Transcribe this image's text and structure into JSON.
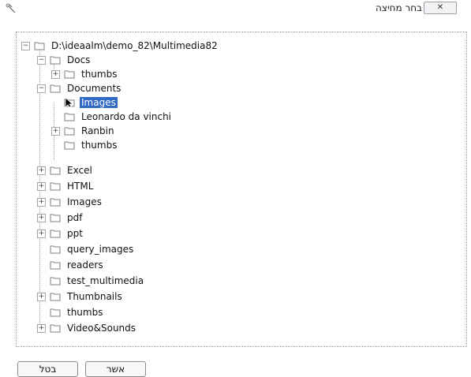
{
  "window": {
    "title": "בחר מחיצה",
    "close_glyph": "✕"
  },
  "tree": {
    "root": {
      "label": "D:\\ideaalm\\demo_82\\Multimedia82",
      "expander": "−"
    },
    "items": [
      {
        "label": "Docs",
        "expander": "−"
      },
      {
        "label": "thumbs",
        "expander": "+"
      },
      {
        "label": "Documents",
        "expander": "−"
      },
      {
        "label": "Images",
        "expander": "",
        "selected": true
      },
      {
        "label": "Leonardo da vinchi",
        "expander": ""
      },
      {
        "label": "Ranbin",
        "expander": "+"
      },
      {
        "label": "thumbs",
        "expander": ""
      },
      {
        "label": "Excel",
        "expander": "+"
      },
      {
        "label": "HTML",
        "expander": "+"
      },
      {
        "label": "Images",
        "expander": "+"
      },
      {
        "label": "pdf",
        "expander": "+"
      },
      {
        "label": "ppt",
        "expander": "+"
      },
      {
        "label": "query_images",
        "expander": ""
      },
      {
        "label": "readers",
        "expander": ""
      },
      {
        "label": "test_multimedia",
        "expander": ""
      },
      {
        "label": "Thumbnails",
        "expander": "+"
      },
      {
        "label": "thumbs",
        "expander": ""
      },
      {
        "label": "Video&Sounds",
        "expander": "+"
      }
    ]
  },
  "buttons": {
    "ok_label": "אשר",
    "cancel_label": "בטל"
  },
  "colors": {
    "selection": "#316AC5",
    "folder_outline": "#7f7f7f"
  },
  "icons": {
    "app": "app-icon",
    "folder": "folder-icon",
    "cursor": "cursor-icon"
  }
}
